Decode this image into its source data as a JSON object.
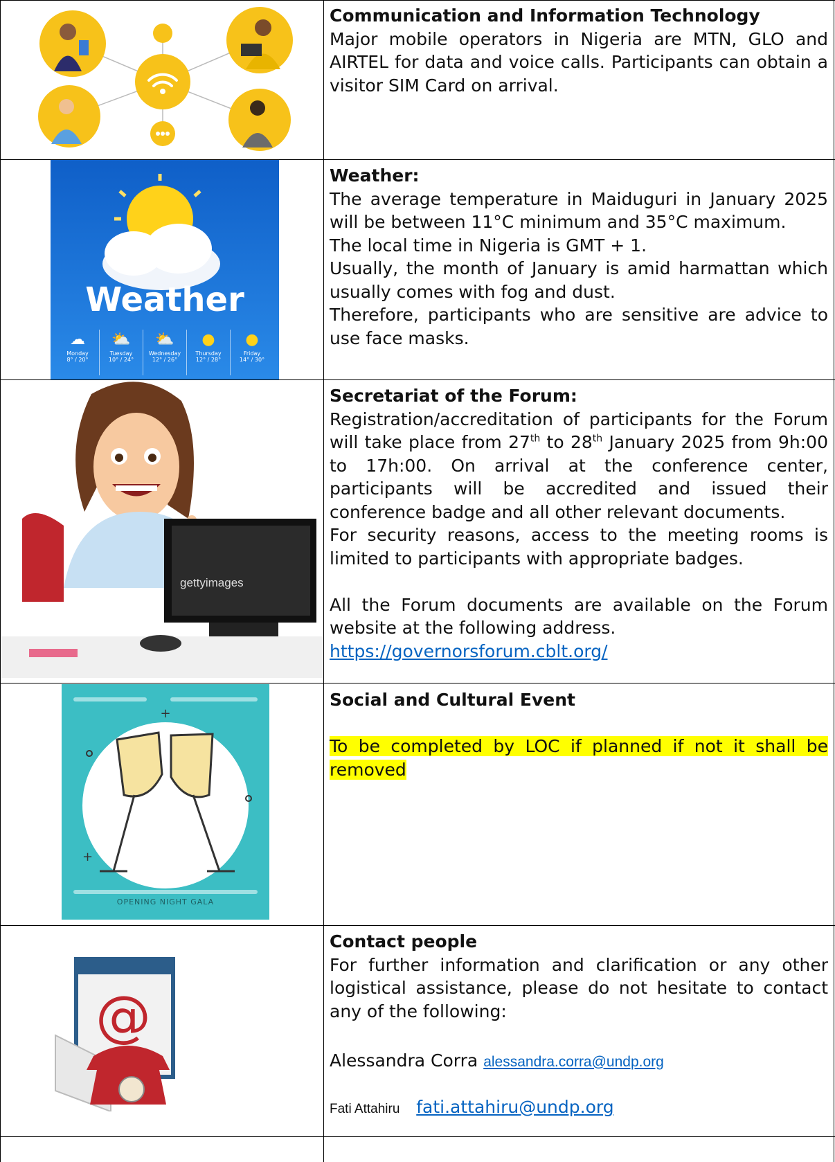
{
  "rows": {
    "communication": {
      "title": "Communication and Information Technology",
      "body": "Major mobile operators in Nigeria are MTN, GLO and AIRTEL for data and voice calls. Participants can obtain a visitor SIM Card on arrival."
    },
    "weather": {
      "title": "Weather:",
      "image_title": "Weather",
      "days": [
        {
          "day": "Monday",
          "temps": "8° / 20°"
        },
        {
          "day": "Tuesday",
          "temps": "10° / 24°"
        },
        {
          "day": "Wednesday",
          "temps": "12° / 26°"
        },
        {
          "day": "Thursday",
          "temps": "12° / 28°"
        },
        {
          "day": "Friday",
          "temps": "14° / 30°"
        }
      ],
      "p1": "The average temperature in Maiduguri in January 2025 will be between 11°C minimum and 35°C maximum.",
      "p2": "The local time in Nigeria is GMT + 1.",
      "p3": "Usually, the month of January is amid harmattan which usually comes with fog and dust.",
      "p4": "Therefore, participants who are sensitive are advice to use face masks."
    },
    "secretariat": {
      "title": "Secretariat of the Forum:",
      "p1_a": "Registration/accreditation of participants for the Forum will take place from 27",
      "sup1": "th",
      "p1_b": " to 28",
      "sup2": "th",
      "p1_c": " January 2025 from 9h:00 to 17h:00. On arrival at the conference center, participants will be accredited and issued their conference badge and all other relevant documents.",
      "p2": "For security reasons, access to the meeting rooms is limited to participants with appropriate badges.",
      "p3": "All the Forum documents are available on the Forum website at the following address.",
      "link": "https://governorsforum.cblt.org/",
      "watermark": "gettyimages"
    },
    "social": {
      "title": "Social and Cultural Event",
      "highlight": "To be completed by LOC if planned if not it shall be removed",
      "image_caption": "OPENING NIGHT GALA"
    },
    "contact": {
      "title": "Contact people",
      "body": "For further information and clarification or any other logistical assistance, please do not hesitate to contact any of the following:",
      "person1_name": "Alessandra Corra",
      "person1_email": "alessandra.corra@undp.org",
      "person2_name": "Fati Attahiru",
      "person2_email": "fati.attahiru@undp.org"
    }
  },
  "colors": {
    "link": "#0563c1",
    "highlight": "#ffff00",
    "weather_bg": "#1e73d8",
    "gala_bg": "#3cbec4",
    "tech_yellow": "#f7c21a"
  }
}
